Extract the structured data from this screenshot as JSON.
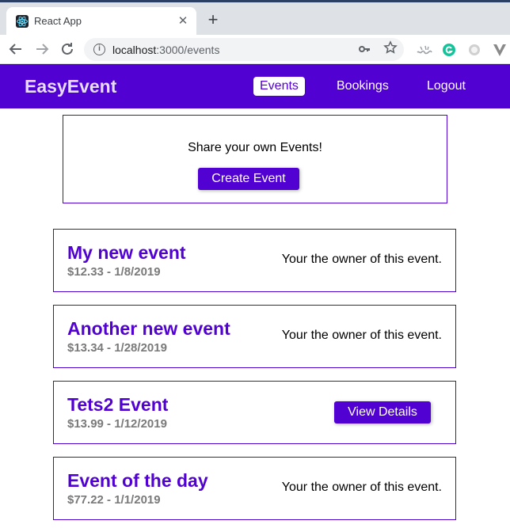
{
  "browser": {
    "tab_title": "React App",
    "tab_close": "✕",
    "new_tab": "+",
    "url_host": "localhost",
    "url_path": ":3000/events",
    "icons": [
      "react-favicon",
      "back-arrow-icon",
      "forward-arrow-icon",
      "reload-icon",
      "info-icon",
      "key-icon",
      "star-icon",
      "ext-icon",
      "grammarly-icon",
      "ext-circle-icon",
      "ext-v-icon"
    ]
  },
  "app": {
    "brand": "EasyEvent",
    "nav": {
      "events": "Events",
      "bookings": "Bookings",
      "logout": "Logout"
    },
    "accent_color": "#5101d1"
  },
  "create": {
    "prompt": "Share your own Events!",
    "button_label": "Create Event"
  },
  "events": [
    {
      "title": "My new event",
      "meta": "$12.33 - 1/8/2019",
      "owner_text": "Your the owner of this event."
    },
    {
      "title": "Another new event",
      "meta": "$13.34 - 1/28/2019",
      "owner_text": "Your the owner of this event."
    },
    {
      "title": "Tets2 Event",
      "meta": "$13.99 - 1/12/2019",
      "button_label": "View Details"
    },
    {
      "title": "Event of the day",
      "meta": "$77.22 - 1/1/2019",
      "owner_text": "Your the owner of this event."
    }
  ]
}
